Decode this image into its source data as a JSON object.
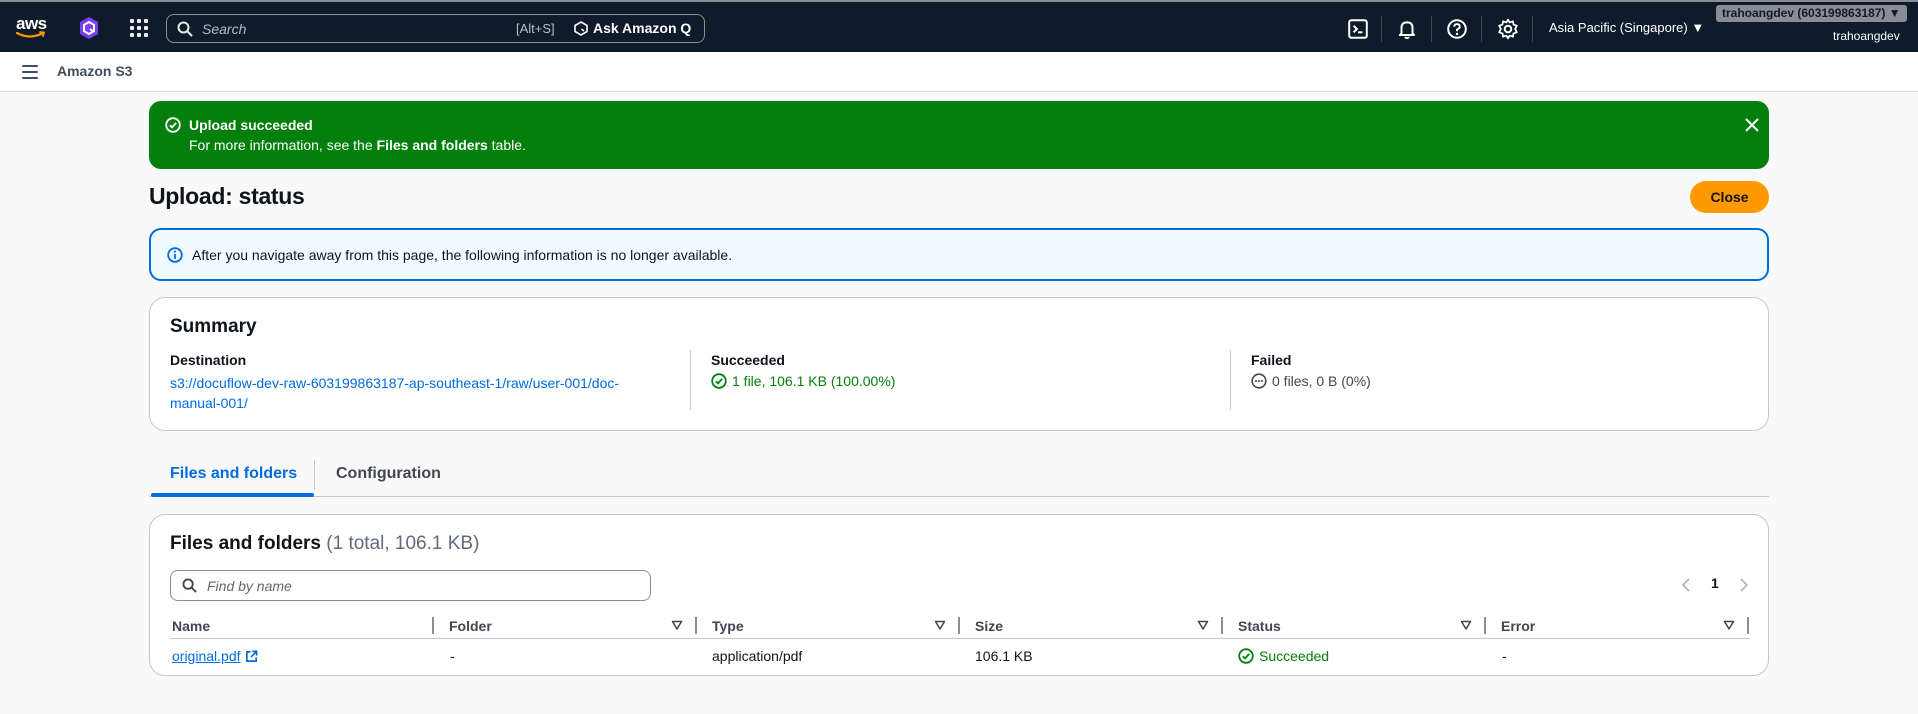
{
  "topnav": {
    "logo_text": "aws",
    "search_placeholder": "Search",
    "search_shortcut": "[Alt+S]",
    "ask_q_label": "Ask Amazon Q",
    "region": "Asia Pacific (Singapore) ▼",
    "account_badge": "trahoangdev (603199863187) ▼",
    "account_user": "trahoangdev"
  },
  "servicebar": {
    "service_name": "Amazon S3"
  },
  "flash": {
    "title": "Upload succeeded",
    "msg_prefix": "For more information, see the ",
    "msg_bold": "Files and folders",
    "msg_suffix": " table."
  },
  "header": {
    "title": "Upload: status",
    "close_label": "Close"
  },
  "info_alert": {
    "text": "After you navigate away from this page, the following information is no longer available."
  },
  "summary": {
    "title": "Summary",
    "destination": {
      "label": "Destination",
      "line1": "s3://docuflow-dev-raw-603199863187-ap-southeast-1/raw/user-001/doc-",
      "line2": "manual-001/"
    },
    "succeeded": {
      "label": "Succeeded",
      "value": "1 file, 106.1 KB (100.00%)"
    },
    "failed": {
      "label": "Failed",
      "value": "0 files, 0 B (0%)"
    }
  },
  "tabs": [
    {
      "label": "Files and folders",
      "active": true
    },
    {
      "label": "Configuration",
      "active": false
    }
  ],
  "files": {
    "title": "Files and folders",
    "count": "(1 total, 106.1 KB)",
    "find_placeholder": "Find by name",
    "page": "1",
    "columns": [
      "Name",
      "Folder",
      "Type",
      "Size",
      "Status",
      "Error"
    ],
    "rows": [
      {
        "name": "original.pdf",
        "folder": "-",
        "type": "application/pdf",
        "size": "106.1 KB",
        "status": "Succeeded",
        "error": "-"
      }
    ]
  },
  "colors": {
    "nav_bg": "#0f1b2a",
    "success": "#037f0c",
    "link": "#006ce0",
    "primary_button": "#ff9900"
  }
}
